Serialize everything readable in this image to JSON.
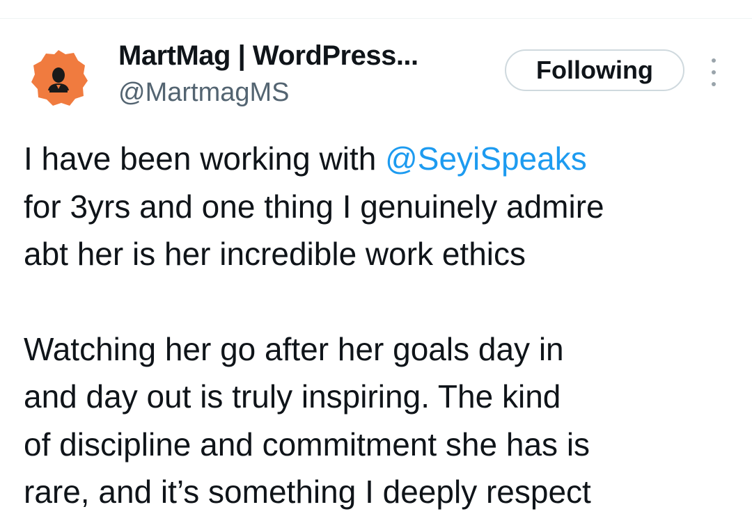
{
  "author": {
    "name": "MartMag | WordPress...",
    "handle": "@MartmagMS",
    "avatar_color": "#f07b3f"
  },
  "follow_button": {
    "label": "Following"
  },
  "more_menu": {
    "icon": "vertical-ellipsis-icon"
  },
  "tweet": {
    "paragraph1": {
      "line1_prefix": "I have been working with ",
      "mention": "@SeyiSpeaks",
      "line2": "for 3yrs and one thing I genuinely admire",
      "line3": "abt her is her incredible work ethics"
    },
    "paragraph2": {
      "line1": "Watching her go after her goals day in",
      "line2": "and day out is truly inspiring. The kind",
      "line3": "of discipline and commitment she has is",
      "line4": "rare, and it’s something I deeply respect"
    }
  },
  "colors": {
    "mention": "#1d9bf0",
    "handle": "#536471",
    "text": "#0f1419",
    "button_border": "#cfd9de"
  }
}
